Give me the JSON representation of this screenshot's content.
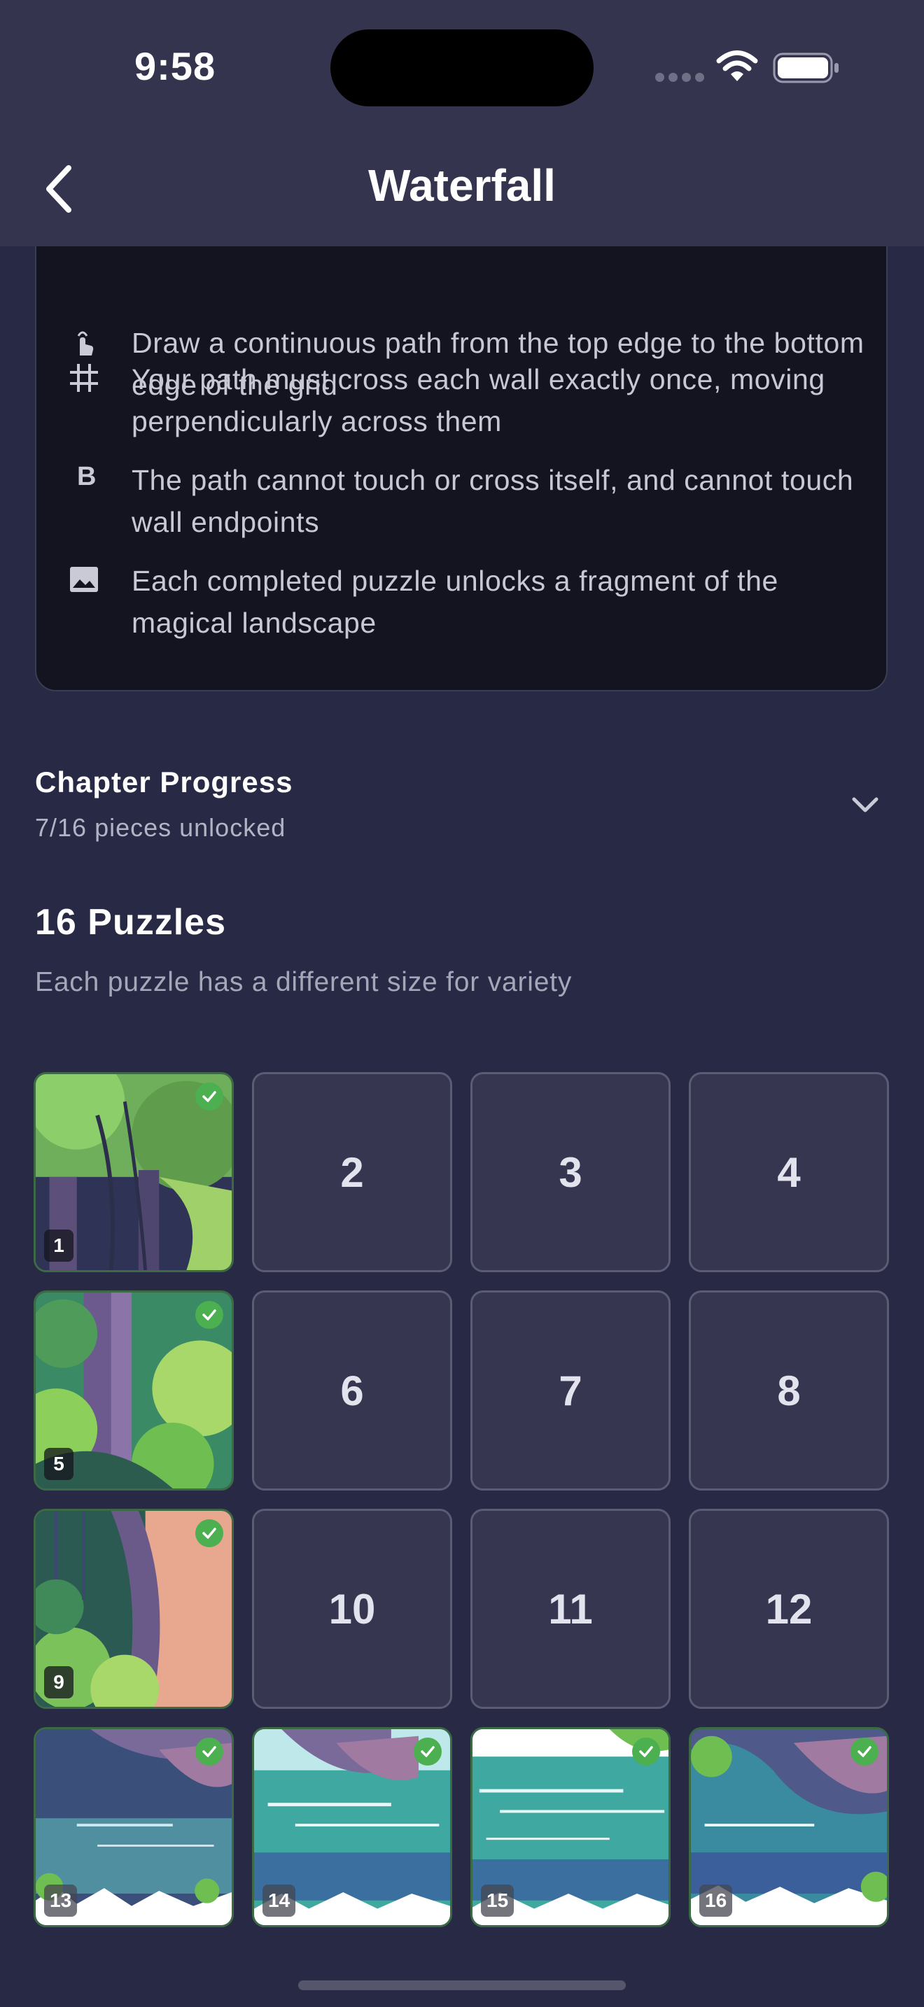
{
  "status_bar": {
    "time": "9:58"
  },
  "nav": {
    "title": "Waterfall",
    "back_icon": "chevron-left-icon"
  },
  "rules": [
    {
      "icon": "tap-icon",
      "text": "Draw a continuous path from the top edge to the bottom edge of the grid"
    },
    {
      "icon": "grid-icon",
      "text": "Your path must cross each wall exactly once, moving perpendicularly across them"
    },
    {
      "icon": "letter-b-icon",
      "glyph": "B",
      "text": "The path cannot touch or cross itself, and cannot touch wall endpoints"
    },
    {
      "icon": "image-icon",
      "text": "Each completed puzzle unlocks a fragment of the magical landscape"
    }
  ],
  "progress": {
    "title": "Chapter Progress",
    "subtitle": "7/16 pieces unlocked",
    "unlocked": 7,
    "total": 16
  },
  "puzzles": {
    "title": "16 Puzzles",
    "subtitle": "Each puzzle has a different size for variety",
    "items": [
      {
        "label": "1",
        "completed": true
      },
      {
        "label": "2",
        "completed": false
      },
      {
        "label": "3",
        "completed": false
      },
      {
        "label": "4",
        "completed": false
      },
      {
        "label": "5",
        "completed": true
      },
      {
        "label": "6",
        "completed": false
      },
      {
        "label": "7",
        "completed": false
      },
      {
        "label": "8",
        "completed": false
      },
      {
        "label": "9",
        "completed": true
      },
      {
        "label": "10",
        "completed": false
      },
      {
        "label": "11",
        "completed": false
      },
      {
        "label": "12",
        "completed": false
      },
      {
        "label": "13",
        "completed": true
      },
      {
        "label": "14",
        "completed": true
      },
      {
        "label": "15",
        "completed": true
      },
      {
        "label": "16",
        "completed": true
      }
    ]
  },
  "colors": {
    "background": "#282945",
    "header": "#35344f",
    "card": "#13141f",
    "tile_locked": "#363651",
    "check_green": "#4caf50"
  }
}
